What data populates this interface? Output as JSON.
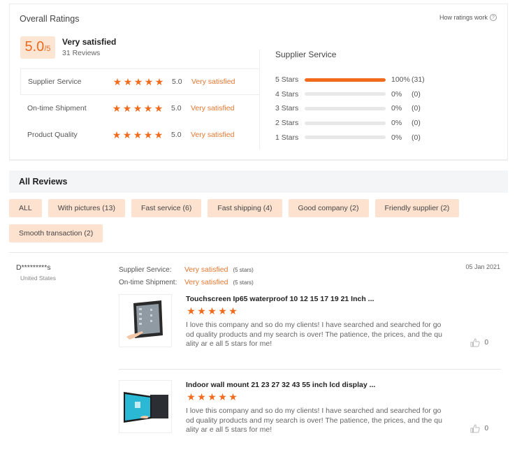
{
  "overall": {
    "title": "Overall Ratings",
    "how_link": "How ratings work",
    "help_icon_glyph": "?",
    "score": "5.0",
    "score_max": "/5",
    "summary_label": "Very satisfied",
    "review_count": "31 Reviews",
    "star_glyph": "★",
    "categories": [
      {
        "label": "Supplier Service",
        "stars": 5,
        "value": "5.0",
        "desc": "Very satisfied",
        "active": true
      },
      {
        "label": "On-time Shipment",
        "stars": 5,
        "value": "5.0",
        "desc": "Very satisfied",
        "active": false
      },
      {
        "label": "Product Quality",
        "stars": 5,
        "value": "5.0",
        "desc": "Very satisfied",
        "active": false
      }
    ]
  },
  "breakdown": {
    "title": "Supplier Service",
    "rows": [
      {
        "label": "5  Stars",
        "fraction": 1.0,
        "percent": "100%",
        "count": "(31)"
      },
      {
        "label": "4  Stars",
        "fraction": 0,
        "percent": "0%",
        "count": "(0)"
      },
      {
        "label": "3  Stars",
        "fraction": 0,
        "percent": "0%",
        "count": "(0)"
      },
      {
        "label": "2  Stars",
        "fraction": 0,
        "percent": "0%",
        "count": "(0)"
      },
      {
        "label": "1  Stars",
        "fraction": 0,
        "percent": "0%",
        "count": "(0)"
      }
    ]
  },
  "reviews_section": {
    "title": "All Reviews",
    "filters": [
      "ALL",
      "With pictures (13)",
      "Fast service (6)",
      "Fast shipping (4)",
      "Good company (2)",
      "Friendly supplier (2)",
      "Smooth transaction (2)"
    ]
  },
  "review": {
    "reviewer": "D*********s",
    "country": "United States",
    "date": "05 Jan 2021",
    "meta": [
      {
        "label": "Supplier Service:",
        "value": "Very satisfied",
        "stars": "(5 stars)"
      },
      {
        "label": "On-time Shipment:",
        "value": "Very satisfied",
        "stars": "(5 stars)"
      }
    ],
    "items": [
      {
        "title": "Touchscreen Ip65 waterproof 10 12 15 17 19 21 Inch ...",
        "stars": 5,
        "text": "I love this company and so do my clients! I have searched and searched for good quality products and my search is over! The patience, the prices, and the quality ar e all 5 stars for me!",
        "likes": "0",
        "image": "open-frame-touchscreen-monitor"
      },
      {
        "title": "Indoor wall mount 21 23 27 32 43 55 inch lcd display ...",
        "stars": 5,
        "text": "I love this company and so do my clients! I have searched and searched for good quality products and my search is over! The patience, the prices, and the quality ar e all 5 stars for me!",
        "likes": "0",
        "image": "wall-mount-lcd-display"
      }
    ]
  },
  "colors": {
    "accent": "#f26b1d",
    "accent_text": "#e8762f",
    "chip_bg": "#fde2d0",
    "score_bg": "#fde5d4",
    "header_bg": "#f4f5f7",
    "track": "#e8e8e8"
  }
}
